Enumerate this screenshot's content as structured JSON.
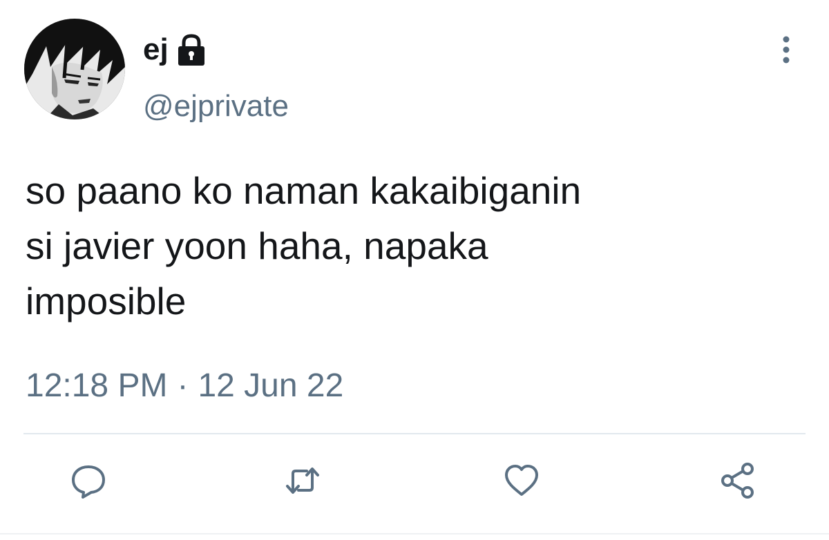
{
  "tweet": {
    "author": {
      "display_name": "ej",
      "handle": "@ejprivate",
      "protected_icon": "lock-icon",
      "avatar": "anime-character-avatar"
    },
    "text": "so paano ko naman kakaibiganin\nsi javier yoon haha, napaka\nimposible",
    "time": "12:18 PM",
    "separator": "·",
    "date": "12 Jun 22",
    "actions": [
      {
        "name": "reply",
        "icon": "speech-bubble-icon"
      },
      {
        "name": "retweet",
        "icon": "retweet-arrows-icon"
      },
      {
        "name": "like",
        "icon": "heart-icon"
      },
      {
        "name": "share",
        "icon": "share-nodes-icon"
      }
    ],
    "menu_icon": "vertical-ellipsis-icon"
  },
  "colors": {
    "text_primary": "#141619",
    "text_secondary": "#5b7083",
    "divider": "#e1e8ed",
    "background": "#ffffff"
  }
}
